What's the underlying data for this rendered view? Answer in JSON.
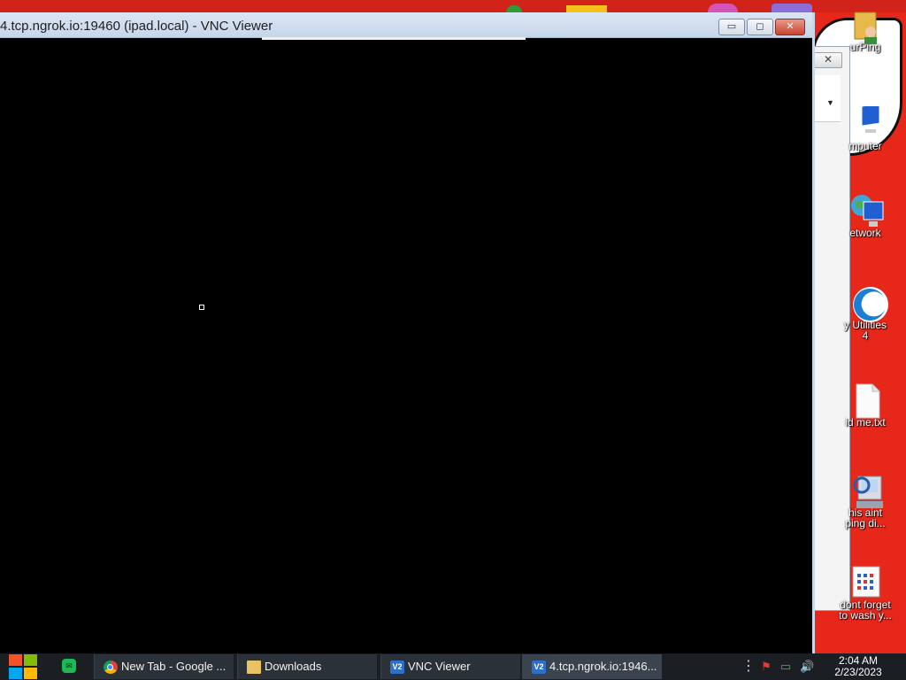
{
  "vnc_window": {
    "title": "4.tcp.ngrok.io:19460 (ipad.local) - VNC Viewer",
    "buttons": {
      "minimize": "▭",
      "maximize": "◻",
      "close": "✕"
    }
  },
  "background_window": {
    "close_symbol": "✕",
    "combo_text": ".",
    "combo_arrow": "▼"
  },
  "desktop_icons": [
    {
      "label": "urPing",
      "icon": "user-folder-icon"
    },
    {
      "label": "mputer",
      "icon": "computer-icon"
    },
    {
      "label": "etwork",
      "icon": "network-icon"
    },
    {
      "label": "y Utilities\n4",
      "icon": "utilities-icon"
    },
    {
      "label": "id me.txt",
      "icon": "text-file-icon"
    },
    {
      "label": "his aint\nping di...",
      "icon": "scanner-icon"
    },
    {
      "label": "dont forget\nto wash y...",
      "icon": "calendar-file-icon"
    }
  ],
  "taskbar": {
    "pinned_app_glyph": "✉",
    "items": [
      {
        "label": "New Tab - Google ...",
        "icon": "chrome-icon"
      },
      {
        "label": "Downloads",
        "icon": "folder-icon"
      },
      {
        "label": "VNC Viewer",
        "icon": "vnc-icon",
        "icon_text": "V2"
      },
      {
        "label": "4.tcp.ngrok.io:1946...",
        "icon": "vnc-icon",
        "icon_text": "V2",
        "active": true
      }
    ],
    "tray": {
      "more": "⋮",
      "flag": "⚑",
      "network": "▭",
      "volume": "🔊"
    },
    "clock": {
      "time": "2:04 AM",
      "date": "2/23/2023"
    }
  },
  "colors": {
    "desktop_bg": "#e8271b",
    "taskbar_bg": "#1b1f23",
    "vnc_canvas": "#000000",
    "titlebar": "#c6d6ea"
  }
}
